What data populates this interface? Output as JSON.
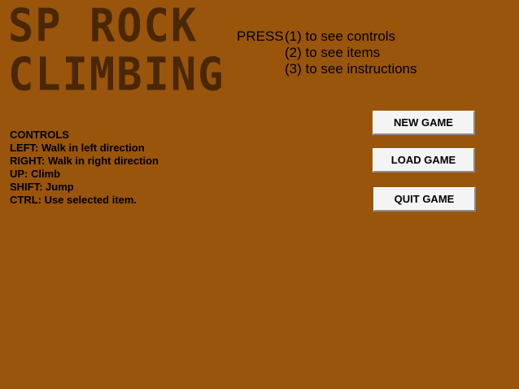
{
  "title": {
    "line1": "SP ROCK",
    "line2": "CLIMBING"
  },
  "press_menu": {
    "prefix": "PRESS",
    "options": [
      "(1) to see controls",
      "(2) to see items",
      "(3) to see instructions"
    ]
  },
  "controls": {
    "heading": "CONTROLS",
    "lines": [
      "LEFT: Walk in left direction",
      "RIGHT: Walk in right direction",
      "UP: Climb",
      "SHIFT: Jump",
      "CTRL: Use selected item."
    ]
  },
  "buttons": {
    "new_game": "NEW GAME",
    "load_game": "LOAD GAME",
    "quit_game": "QUIT GAME"
  },
  "colors": {
    "background": "#99550b",
    "title": "#4a2705",
    "button_face": "#f4f4f4"
  }
}
